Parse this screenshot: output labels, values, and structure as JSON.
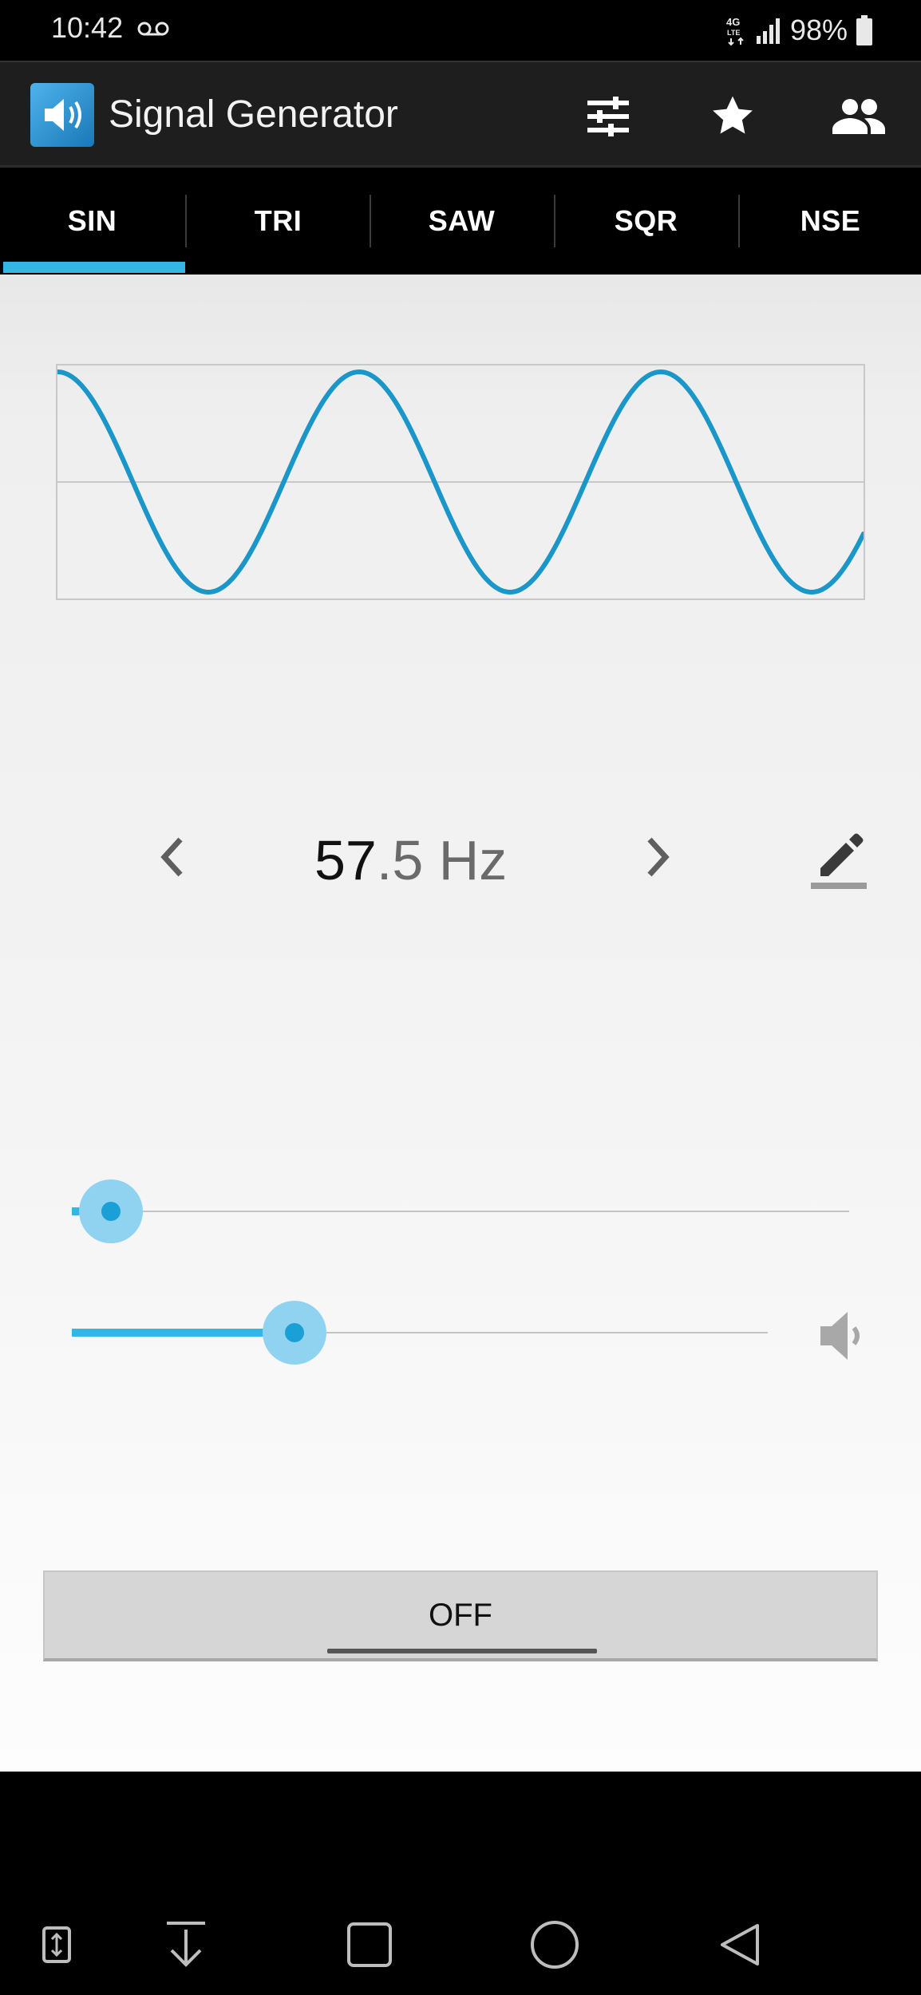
{
  "status_bar": {
    "time": "10:42",
    "network": "4G LTE",
    "battery": "98%",
    "icons": [
      "voicemail-icon",
      "signal-icon",
      "battery-icon"
    ]
  },
  "app_bar": {
    "title": "Signal Generator",
    "actions": [
      "sliders-icon",
      "star-icon",
      "people-icon"
    ]
  },
  "tabs": [
    {
      "label": "SIN",
      "selected": true
    },
    {
      "label": "TRI",
      "selected": false
    },
    {
      "label": "SAW",
      "selected": false
    },
    {
      "label": "SQR",
      "selected": false
    },
    {
      "label": "NSE",
      "selected": false
    }
  ],
  "waveform": {
    "type": "sine",
    "color": "#1a96c8"
  },
  "frequency": {
    "integer_part": "57",
    "decimal_part": ".5 Hz"
  },
  "frequency_slider": {
    "level": 0.05
  },
  "volume_slider": {
    "level": 0.32
  },
  "toggle_button": {
    "label": "OFF"
  },
  "colors": {
    "accent": "#33b5e5",
    "app_bar": "#1e1e1e",
    "tab_bar": "#000000"
  },
  "nav_bar": {
    "icons": [
      "screen-pin-icon",
      "download-icon",
      "recents-icon",
      "home-icon",
      "back-icon"
    ]
  }
}
